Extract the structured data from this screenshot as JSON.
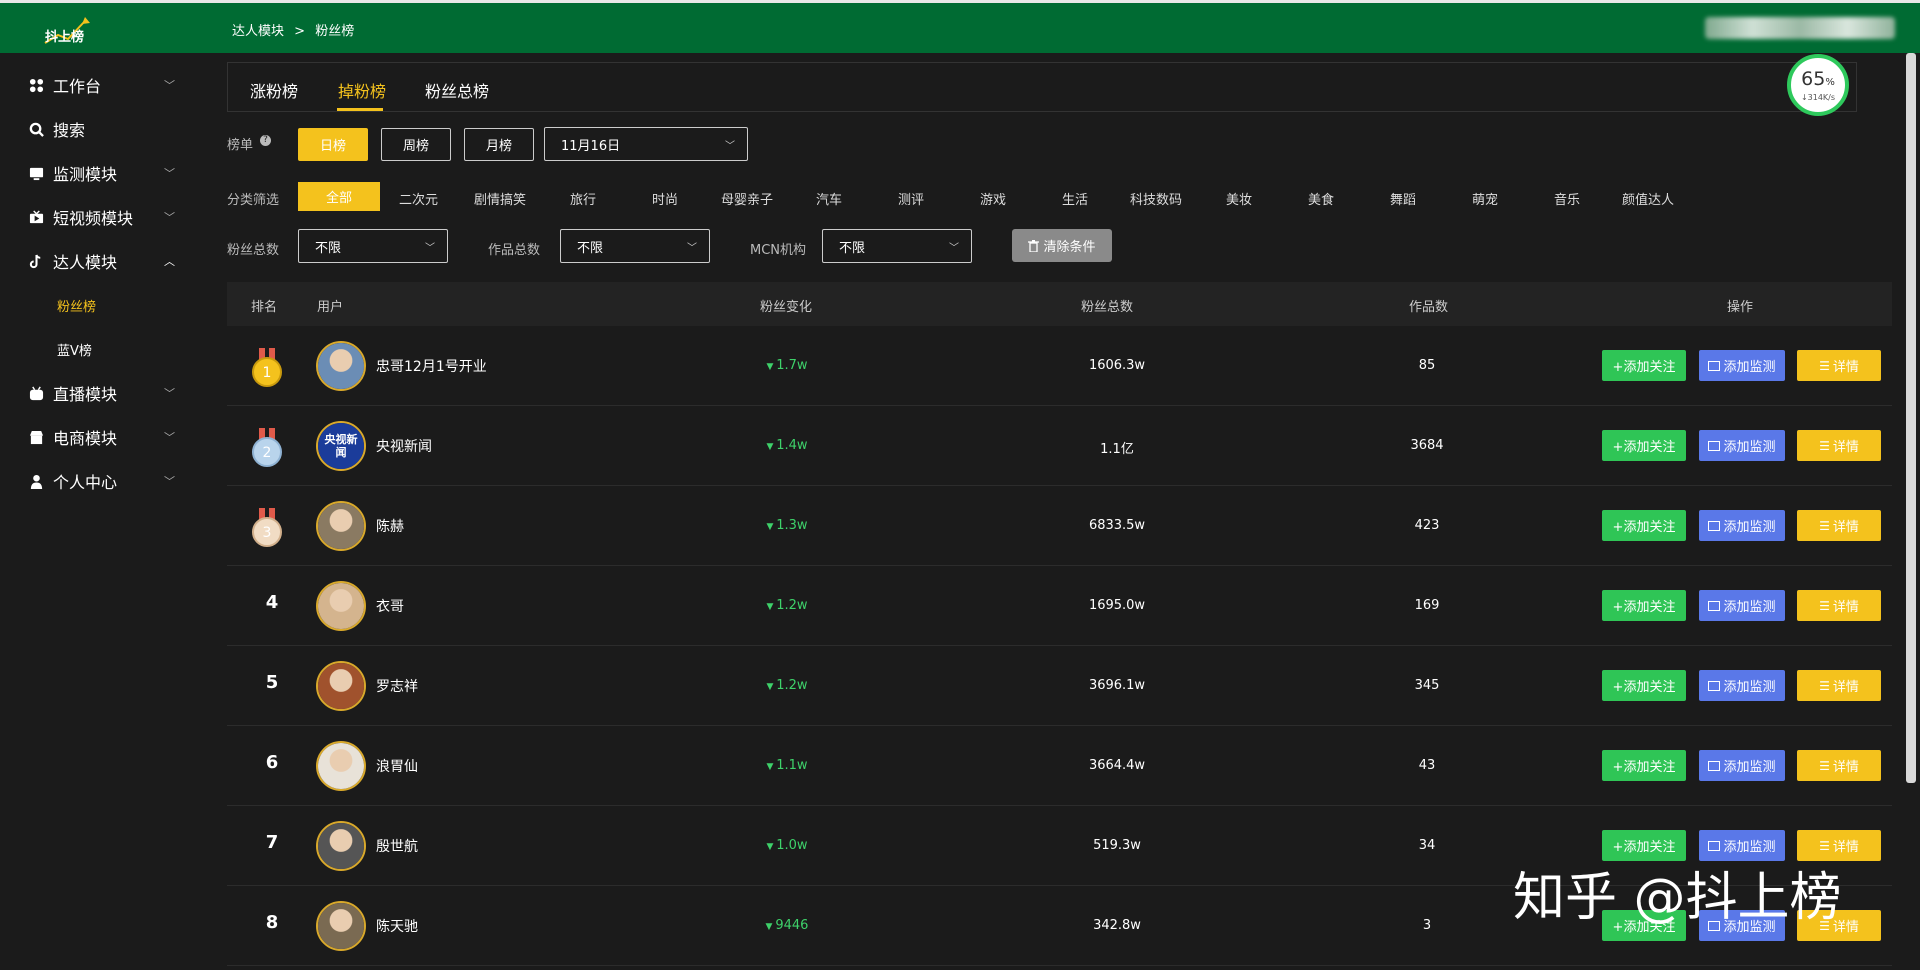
{
  "app": {
    "logo": "抖上榜"
  },
  "breadcrumb": {
    "parent": "达人模块",
    "sep": ">",
    "current": "粉丝榜"
  },
  "sidebar": {
    "items": [
      {
        "label": "工作台",
        "icon": "grid-icon",
        "expand": "chevron-down"
      },
      {
        "label": "搜索",
        "icon": "search-icon",
        "expand": ""
      },
      {
        "label": "监测模块",
        "icon": "monitor-icon",
        "expand": "chevron-down"
      },
      {
        "label": "短视频模块",
        "icon": "video-icon",
        "expand": "chevron-down"
      },
      {
        "label": "达人模块",
        "icon": "tiktok-icon",
        "expand": "chevron-up"
      },
      {
        "label": "直播模块",
        "icon": "tv-icon",
        "expand": "chevron-down"
      },
      {
        "label": "电商模块",
        "icon": "store-icon",
        "expand": "chevron-down"
      },
      {
        "label": "个人中心",
        "icon": "user-icon",
        "expand": "chevron-down"
      }
    ],
    "sub_items": [
      {
        "label": "粉丝榜",
        "active": true
      },
      {
        "label": "蓝V榜",
        "active": false
      }
    ]
  },
  "tabs": [
    {
      "label": "涨粉榜",
      "active": false
    },
    {
      "label": "掉粉榜",
      "active": true
    },
    {
      "label": "粉丝总榜",
      "active": false
    }
  ],
  "network": {
    "percent": "65",
    "unit": "%",
    "rate": "↓314K/s"
  },
  "filters": {
    "list_label": "榜单",
    "period_buttons": [
      {
        "label": "日榜",
        "active": true
      },
      {
        "label": "周榜",
        "active": false
      },
      {
        "label": "月榜",
        "active": false
      }
    ],
    "date_value": "11月16日",
    "category_label": "分类筛选",
    "categories": [
      "全部",
      "二次元",
      "剧情搞笑",
      "旅行",
      "时尚",
      "母婴亲子",
      "汽车",
      "测评",
      "游戏",
      "生活",
      "科技数码",
      "美妆",
      "美食",
      "舞蹈",
      "萌宠",
      "音乐",
      "颜值达人"
    ],
    "fans_total_label": "粉丝总数",
    "fans_total_value": "不限",
    "works_total_label": "作品总数",
    "works_total_value": "不限",
    "mcn_label": "MCN机构",
    "mcn_value": "不限",
    "clear_label": "清除条件"
  },
  "table": {
    "headers": {
      "rank": "排名",
      "user": "用户",
      "change": "粉丝变化",
      "fans": "粉丝总数",
      "works": "作品数",
      "ops": "操作"
    },
    "actions": {
      "follow": "+添加关注",
      "monitor": "添加监测",
      "detail": "详情"
    },
    "rows": [
      {
        "rank": "1",
        "name": "忠哥12月1号开业",
        "change": "1.7w",
        "fans": "1606.3w",
        "works": "85",
        "avatar_color": "#6b8db5"
      },
      {
        "rank": "2",
        "name": "央视新闻",
        "change": "1.4w",
        "fans": "1.1亿",
        "works": "3684",
        "avatar_color": "#1b3c9a",
        "avatar_text": "央视新闻"
      },
      {
        "rank": "3",
        "name": "陈赫",
        "change": "1.3w",
        "fans": "6833.5w",
        "works": "423",
        "avatar_color": "#8a7a62"
      },
      {
        "rank": "4",
        "name": "衣哥",
        "change": "1.2w",
        "fans": "1695.0w",
        "works": "169",
        "avatar_color": "#d4b48e"
      },
      {
        "rank": "5",
        "name": "罗志祥",
        "change": "1.2w",
        "fans": "3696.1w",
        "works": "345",
        "avatar_color": "#a0522d"
      },
      {
        "rank": "6",
        "name": "浪胃仙",
        "change": "1.1w",
        "fans": "3664.4w",
        "works": "43",
        "avatar_color": "#e8e2d8"
      },
      {
        "rank": "7",
        "name": "殷世航",
        "change": "1.0w",
        "fans": "519.3w",
        "works": "34",
        "avatar_color": "#555555"
      },
      {
        "rank": "8",
        "name": "陈天驰",
        "change": "9446",
        "fans": "342.8w",
        "works": "3",
        "avatar_color": "#7a6a52"
      }
    ]
  },
  "watermark": "知乎 @抖上榜"
}
